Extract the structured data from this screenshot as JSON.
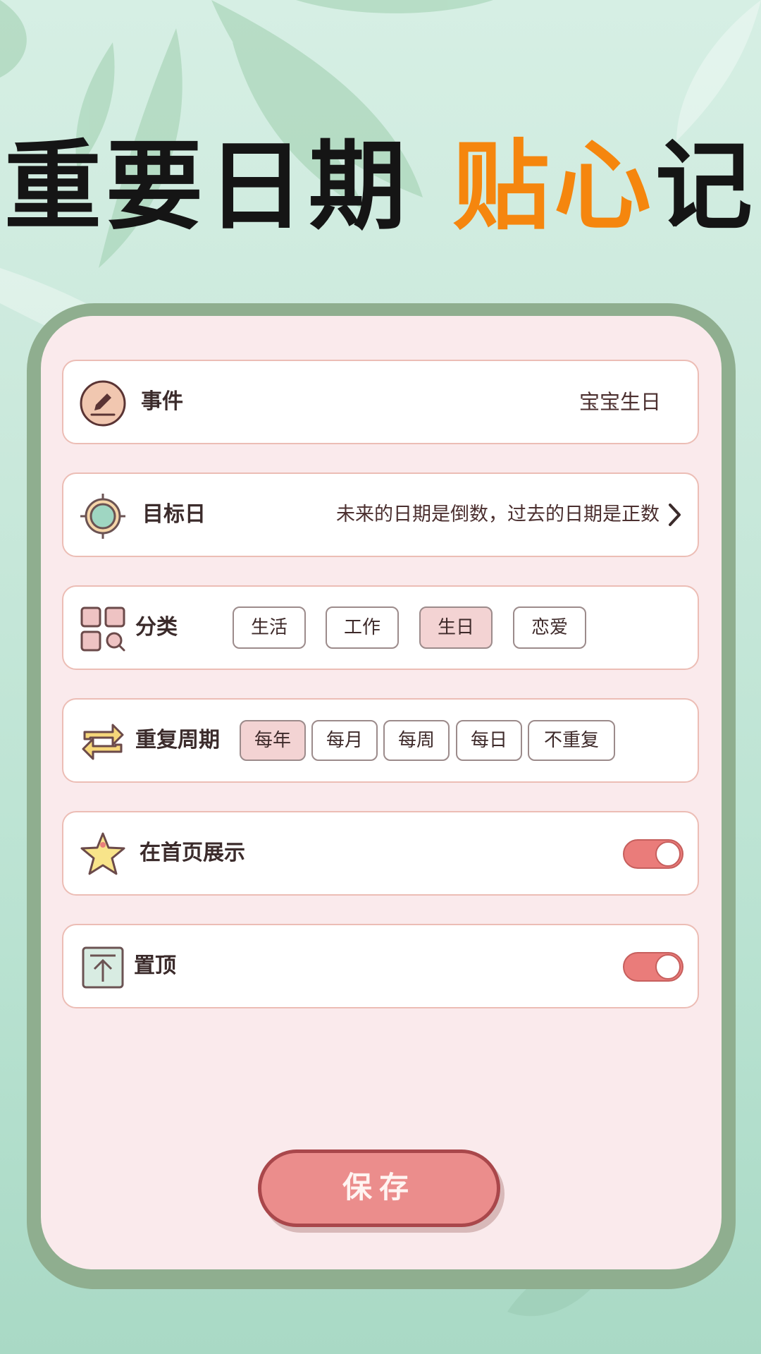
{
  "headline": {
    "part1": "重要日期",
    "part2": "贴心",
    "part3": "记"
  },
  "form": {
    "event": {
      "label": "事件",
      "value": "宝宝生日"
    },
    "target": {
      "label": "目标日",
      "hint": "未来的日期是倒数，过去的日期是正数"
    },
    "category": {
      "label": "分类",
      "options": [
        "生活",
        "工作",
        "生日",
        "恋爱"
      ],
      "selected": "生日"
    },
    "repeat": {
      "label": "重复周期",
      "options": [
        "每年",
        "每月",
        "每周",
        "每日",
        "不重复"
      ],
      "selected": "每年"
    },
    "show_home": {
      "label": "在首页展示",
      "enabled": true
    },
    "pin_top": {
      "label": "置顶",
      "enabled": true
    }
  },
  "save_label": "保存",
  "colors": {
    "accent_orange": "#f5860e",
    "frame_green": "#8fae8f",
    "screen_pink": "#faeaec",
    "toggle_on": "#ea7c7a",
    "save_button": "#eb8d8c"
  },
  "icons": [
    "pencil-icon",
    "target-icon",
    "category-grid-icon",
    "repeat-icon",
    "star-icon",
    "pin-top-icon",
    "chevron-right-icon"
  ]
}
